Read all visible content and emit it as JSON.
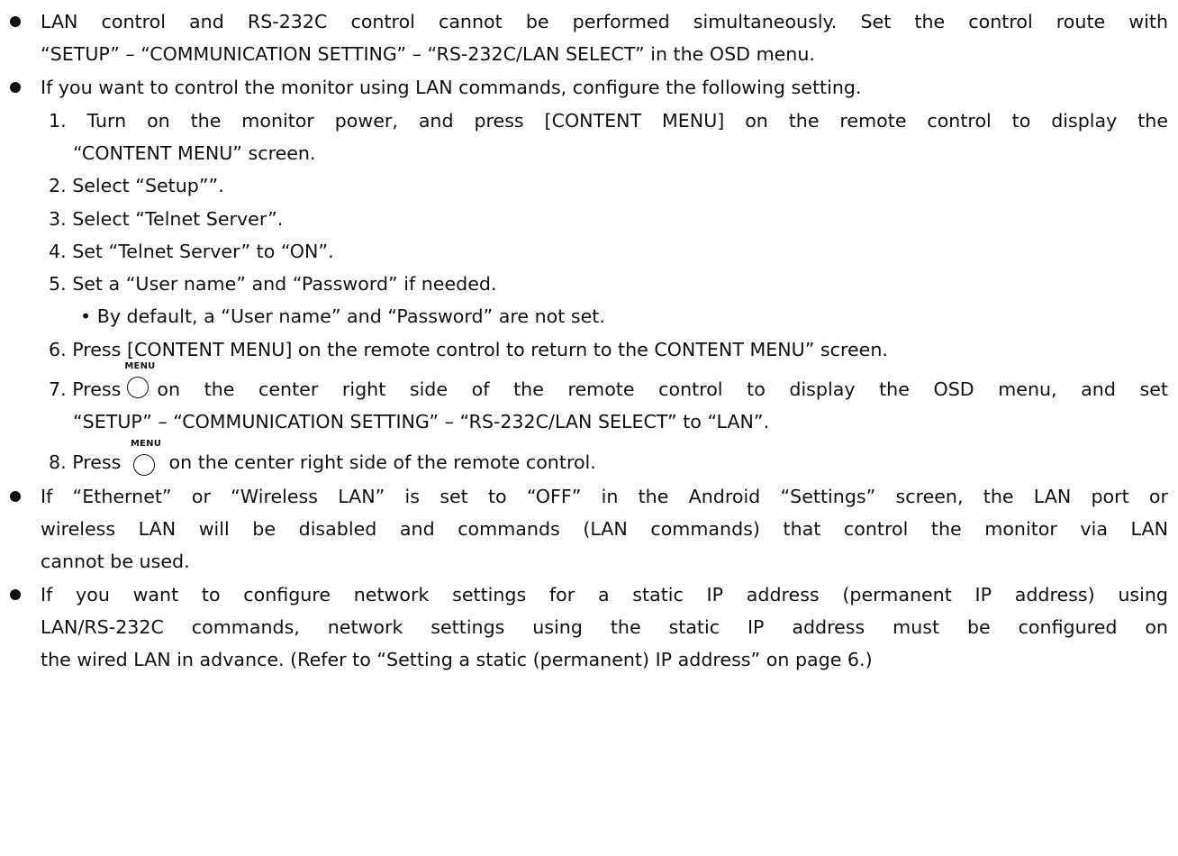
{
  "b1": {
    "l1": "LAN control and RS-232C control cannot be performed simultaneously. Set the control route with",
    "l2": "“SETUP” – “COMMUNICATION SETTING” – “RS-232C/LAN SELECT” in the OSD menu."
  },
  "b2": {
    "intro": "If you want to control the monitor using LAN commands, configure the following setting.",
    "s1a": "1. Turn on the monitor power, and press [CONTENT MENU] on the remote control to display the",
    "s1b": "“CONTENT MENU” screen.",
    "s2": "2. Select “Setup””.",
    "s3": "3. Select “Telnet Server”.",
    "s4": "4. Set “Telnet Server” to “ON”.",
    "s5": "5. Set a “User name” and “Password” if needed.",
    "s5sub": "• By default, a “User name” and “Password” are not set.",
    "s6": "6. Press [CONTENT MENU] on the remote control to return to the CONTENT MENU” screen.",
    "s7pre": "7. Press",
    "s7post": "on the center right side of the remote control to display the OSD menu, and set",
    "s7b": "“SETUP” – “COMMUNICATION SETTING” – “RS-232C/LAN SELECT” to “LAN”.",
    "s8pre": "8. Press",
    "s8post": "on the center right side of the remote control.",
    "menu_icon_label": "MENU"
  },
  "b3": {
    "l1": "If “Ethernet” or “Wireless LAN” is set to “OFF” in the Android “Settings” screen, the LAN port or",
    "l2": "wireless LAN will be disabled and commands (LAN commands) that control the monitor via LAN",
    "l3": "cannot be used."
  },
  "b4": {
    "l1": "If you want to configure network settings for a static IP address (permanent IP address) using",
    "l2": "LAN/RS-232C commands, network settings using the static IP address must be configured on",
    "l3": "the wired LAN in advance. (Refer to “Setting a static (permanent) IP address” on page 6.)"
  }
}
